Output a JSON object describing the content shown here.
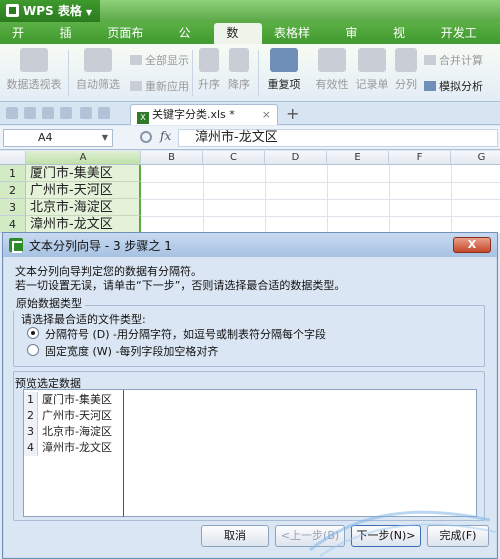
{
  "app": {
    "name": "WPS 表格"
  },
  "ribbon_tabs": [
    {
      "label": "开始",
      "active": false
    },
    {
      "label": "插入",
      "active": false
    },
    {
      "label": "页面布局",
      "active": false
    },
    {
      "label": "公式",
      "active": false
    },
    {
      "label": "数据",
      "active": true
    },
    {
      "label": "表格样式",
      "active": false
    },
    {
      "label": "审阅",
      "active": false
    },
    {
      "label": "视图",
      "active": false
    },
    {
      "label": "开发工具",
      "active": false
    }
  ],
  "ribbon": {
    "pivot": "数据透视表",
    "autofilter": "自动筛选",
    "show_all": "全部显示",
    "reapply": "重新应用",
    "sort_asc": "升序",
    "sort_desc": "降序",
    "duplicates": "重复项",
    "validity": "有效性",
    "record_form": "记录单",
    "split": "分列",
    "merge_calc": "合并计算",
    "what_if": "模拟分析"
  },
  "document": {
    "tab_name": "关键字分类.xls *"
  },
  "formula_bar": {
    "name_box": "A4",
    "fx": "fx",
    "value": "漳州市-龙文区"
  },
  "sheet": {
    "columns": [
      "A",
      "B",
      "C",
      "D",
      "E",
      "F",
      "G"
    ],
    "rows": [
      {
        "num": "1",
        "a": "厦门市-集美区"
      },
      {
        "num": "2",
        "a": "广州市-天河区"
      },
      {
        "num": "3",
        "a": "北京市-海淀区"
      },
      {
        "num": "4",
        "a": "漳州市-龙文区"
      }
    ]
  },
  "dialog": {
    "title": "文本分列向导 - 3 步骤之 1",
    "close_label": "X",
    "desc1": "文本分列向导判定您的数据有分隔符。",
    "desc2": "若一切设置无误，请单击“下一步”，否则请选择最合适的数据类型。",
    "group_title": "原始数据类型",
    "choose_label": "请选择最合适的文件类型:",
    "options": [
      {
        "label": "分隔符号 (D)  -用分隔字符，如逗号或制表符分隔每个字段",
        "selected": true
      },
      {
        "label": "固定宽度 (W)  -每列字段加空格对齐",
        "selected": false
      }
    ],
    "preview_title": "预览选定数据",
    "preview_rows": [
      {
        "num": "1",
        "text": "厦门市-集美区"
      },
      {
        "num": "2",
        "text": "广州市-天河区"
      },
      {
        "num": "3",
        "text": "北京市-海淀区"
      },
      {
        "num": "4",
        "text": "漳州市-龙文区"
      }
    ],
    "buttons": {
      "cancel": "取消",
      "back": "<上一步(B)",
      "next": "下一步(N)>",
      "finish": "完成(F)"
    }
  }
}
